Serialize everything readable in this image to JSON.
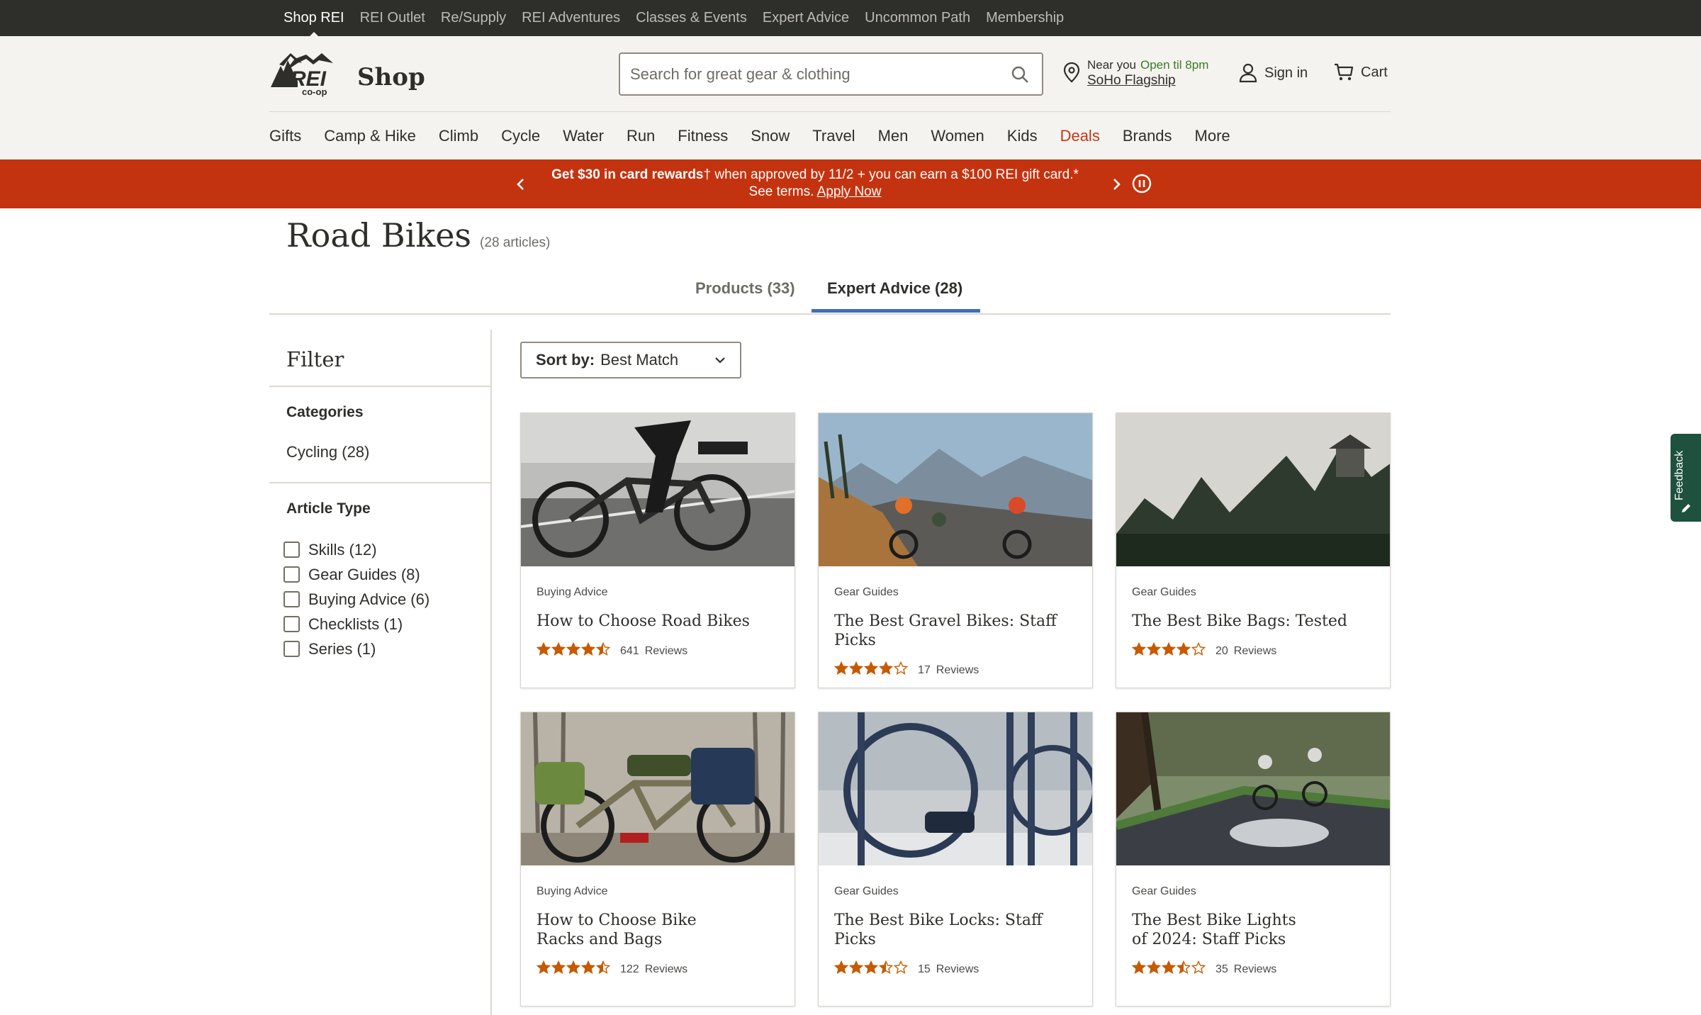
{
  "topbar": {
    "links": [
      "Shop REI",
      "REI Outlet",
      "Re/Supply",
      "REI Adventures",
      "Classes & Events",
      "Expert Advice",
      "Uncommon Path",
      "Membership"
    ]
  },
  "header": {
    "logo_text": "REI co-op",
    "shop_label": "Shop",
    "search_placeholder": "Search for great gear & clothing",
    "store_near": "Near you",
    "store_hours": "Open til 8pm",
    "store_name": "SoHo Flagship",
    "signin_label": "Sign in",
    "cart_label": "Cart"
  },
  "mainnav": {
    "items": [
      "Gifts",
      "Camp & Hike",
      "Climb",
      "Cycle",
      "Water",
      "Run",
      "Fitness",
      "Snow",
      "Travel",
      "Men",
      "Women",
      "Kids",
      "Deals",
      "Brands",
      "More"
    ]
  },
  "promo": {
    "bold_text": "Get $30 in card rewards",
    "dagger": "†",
    "text": " when approved by 11/2 + you can earn a $100 REI gift card.*",
    "terms": "See terms.",
    "link": "Apply Now"
  },
  "page": {
    "title": "Road Bikes",
    "count": "(28 articles)"
  },
  "tabs": {
    "products": "Products (33)",
    "advice": "Expert Advice (28)"
  },
  "filter": {
    "title": "Filter",
    "categories_heading": "Categories",
    "categories": [
      "Cycling (28)"
    ],
    "article_type_heading": "Article Type",
    "article_types": [
      "Skills (12)",
      "Gear Guides (8)",
      "Buying Advice (6)",
      "Checklists (1)",
      "Series (1)"
    ]
  },
  "sort": {
    "label": "Sort by:",
    "value": "Best Match"
  },
  "cards": [
    {
      "category": "Buying Advice",
      "title": "How to Choose Road Bikes",
      "rating": 4.5,
      "reviews_count": "641",
      "reviews_label": "Reviews"
    },
    {
      "category": "Gear Guides",
      "title": "The Best Gravel Bikes: Staff Picks",
      "rating": 4,
      "reviews_count": "17",
      "reviews_label": "Reviews"
    },
    {
      "category": "Gear Guides",
      "title": "The Best Bike Bags: Tested",
      "rating": 4,
      "reviews_count": "20",
      "reviews_label": "Reviews"
    },
    {
      "category": "Buying Advice",
      "title": "How to Choose Bike Racks and Bags",
      "rating": 4.5,
      "reviews_count": "122",
      "reviews_label": "Reviews"
    },
    {
      "category": "Gear Guides",
      "title": "The Best Bike Locks: Staff Picks",
      "rating": 3.5,
      "reviews_count": "15",
      "reviews_label": "Reviews"
    },
    {
      "category": "Gear Guides",
      "title": "The Best Bike Lights of 2024: Staff Picks",
      "rating": 3.5,
      "reviews_count": "35",
      "reviews_label": "Reviews"
    }
  ],
  "feedback": {
    "label": "Feedback"
  },
  "colors": {
    "promo_bg": "#c4330f",
    "deals": "#c0381a",
    "tab_underline": "#406eb5",
    "star": "#c65a00",
    "topbar_bg": "#2e2e2b",
    "header_bg": "#f5f3ef",
    "feedback_bg": "#1f513f"
  }
}
